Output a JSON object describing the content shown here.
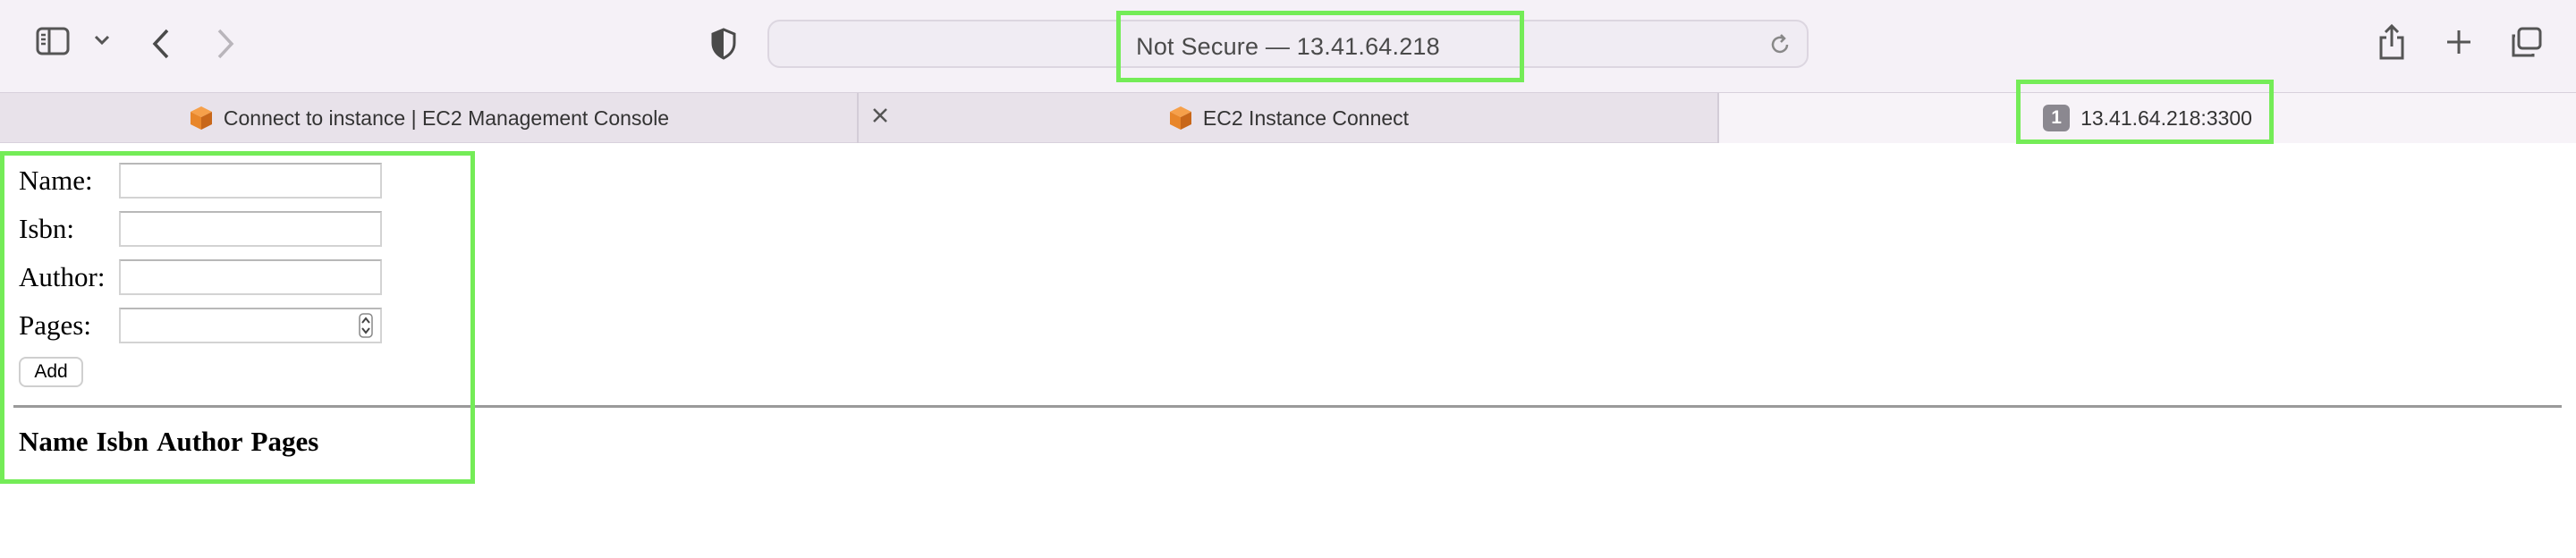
{
  "browser": {
    "address_text": "Not Secure — 13.41.64.218",
    "tabs": [
      {
        "label": "Connect to instance | EC2 Management Console",
        "icon": "aws-cube-icon"
      },
      {
        "label": "EC2 Instance Connect",
        "icon": "aws-cube-icon"
      },
      {
        "label": "13.41.64.218:3300",
        "badge": "1"
      }
    ]
  },
  "form": {
    "fields": [
      {
        "label": "Name:",
        "value": ""
      },
      {
        "label": "Isbn:",
        "value": ""
      },
      {
        "label": "Author:",
        "value": ""
      },
      {
        "label": "Pages:",
        "value": ""
      }
    ],
    "add_label": "Add"
  },
  "table": {
    "headers": [
      "Name",
      "Isbn",
      "Author",
      "Pages"
    ]
  },
  "colors": {
    "highlight": "#74ec57",
    "toolbar_bg": "#f5f1f7",
    "tab_bar_bg": "#e8e2ea",
    "aws_orange": "#e8862a"
  }
}
